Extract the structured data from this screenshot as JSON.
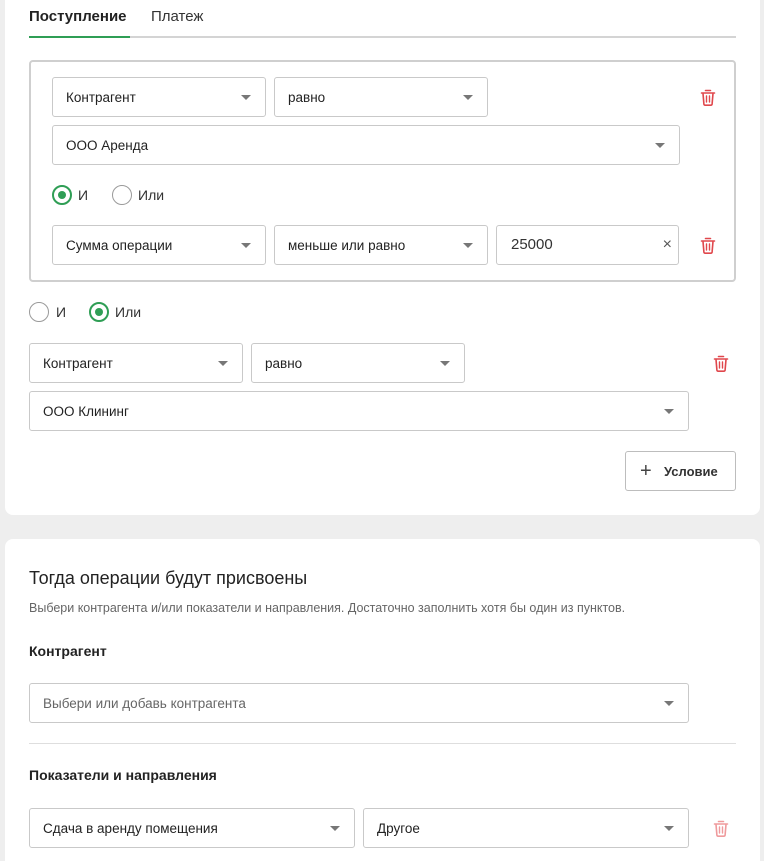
{
  "tabs": {
    "active": "Поступление",
    "inactive": "Платеж"
  },
  "group": {
    "row1": {
      "field": "Контрагент",
      "operator": "равно",
      "value": "ООО Аренда"
    },
    "logic": {
      "and_label": "И",
      "or_label": "Или",
      "selected": "and"
    },
    "row2": {
      "field": "Сумма операции",
      "operator": "меньше или равно",
      "value": "25000",
      "clear_glyph": "×"
    }
  },
  "outer_logic": {
    "and_label": "И",
    "or_label": "Или",
    "selected": "or"
  },
  "condition3": {
    "field": "Контрагент",
    "operator": "равно",
    "value": "ООО Клининг"
  },
  "add_condition": {
    "plus_glyph": "+",
    "label": "Условие"
  },
  "assign": {
    "title": "Тогда операции будут присвоены",
    "description": "Выбери контрагента и/или показатели и направления. Достаточно заполнить хотя бы один из пунктов.",
    "counterparty_label": "Контрагент",
    "counterparty_placeholder": "Выбери или добавь контрагента",
    "indicators_label": "Показатели и направления",
    "indicator": "Сдача в аренду помещения",
    "direction": "Другое"
  },
  "colors": {
    "accent": "#2f9e55",
    "delete": "#e0474c",
    "delete_muted": "#ef9a9c"
  },
  "icons": {
    "delete": "trash-icon",
    "dropdown": "chevron-down-icon",
    "clear": "close-icon",
    "add": "plus-icon"
  }
}
